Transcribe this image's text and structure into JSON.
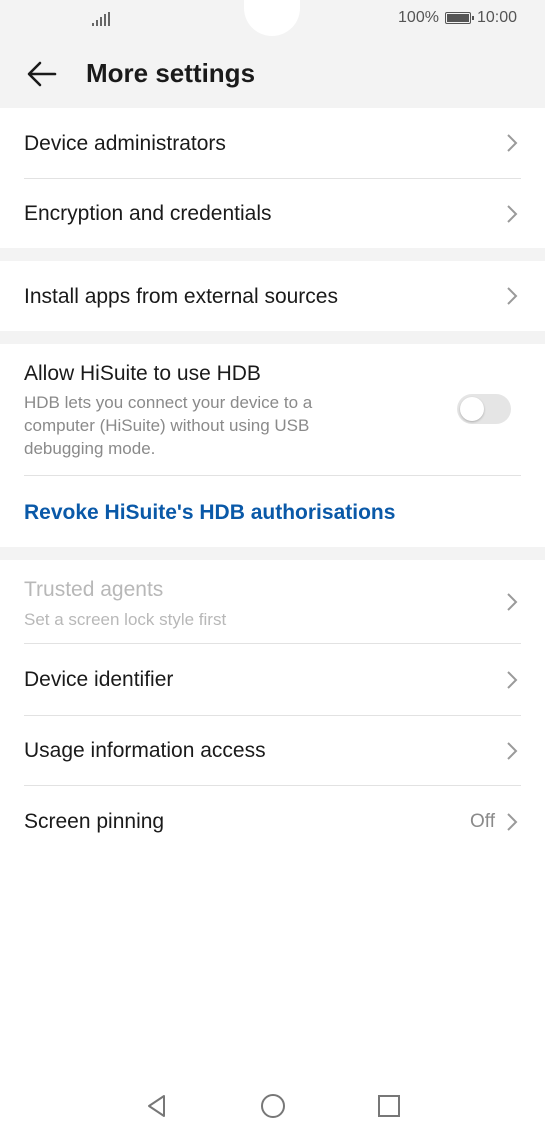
{
  "status": {
    "battery_text": "100%",
    "time": "10:00"
  },
  "header": {
    "title": "More settings"
  },
  "group1": [
    {
      "label": "Device administrators"
    },
    {
      "label": "Encryption and credentials"
    }
  ],
  "group2": [
    {
      "label": "Install apps from external sources"
    }
  ],
  "group3": {
    "hdb_title": "Allow HiSuite to use HDB",
    "hdb_desc": "HDB lets you connect your device to a computer (HiSuite) without using USB debugging mode.",
    "hdb_enabled": false,
    "revoke_link": "Revoke HiSuite's HDB authorisations"
  },
  "group4": {
    "trusted_title": "Trusted agents",
    "trusted_sub": "Set a screen lock style first",
    "device_identifier": "Device identifier",
    "usage_access": "Usage information access",
    "screen_pinning": "Screen pinning",
    "screen_pinning_value": "Off"
  },
  "colors": {
    "link": "#0a59a8",
    "background_grey": "#f3f3f3",
    "toggle_off": "#e5e5e5"
  },
  "icons": {
    "back": "arrow-left-icon",
    "chevron": "chevron-right-icon",
    "nav_back": "triangle-back-icon",
    "nav_home": "circle-home-icon",
    "nav_recent": "square-recent-icon"
  }
}
